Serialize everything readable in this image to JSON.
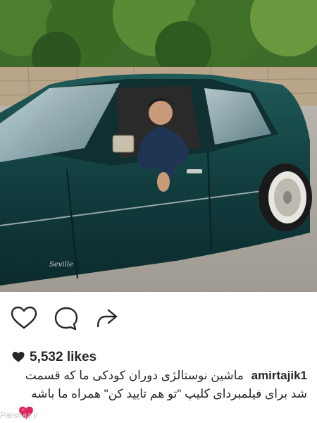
{
  "post": {
    "likes": "5,532 likes",
    "username": "amirtajik1",
    "caption_line1": "ماشین نوستالژی دوران کودکی ما که قسمت",
    "caption_line2": "شد برای فیلمبردای کلیپ \"تو هم تایید کن\" همراه ما باشه",
    "car_badge": "Seville"
  },
  "actions": {
    "like_icon": "heart-outline-icon",
    "comment_icon": "comment-bubble-icon",
    "share_icon": "share-arrow-icon"
  },
  "watermark": "Parsnaz.ir",
  "colors": {
    "text": "#262626",
    "heart_emoji": "#e0245e",
    "watermark": "#c9c9c9"
  }
}
